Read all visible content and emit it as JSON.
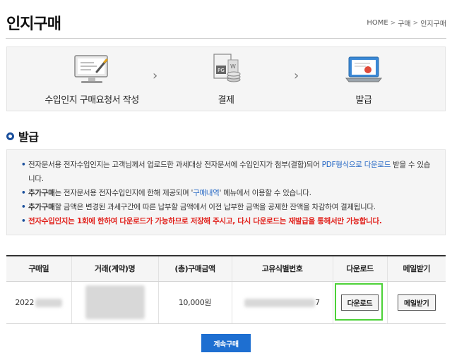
{
  "page": {
    "title": "인지구매"
  },
  "breadcrumb": {
    "home": "HOME",
    "sep": ">",
    "level1": "구매",
    "level2": "인지구매"
  },
  "steps": [
    {
      "label": "수입인지 구매요청서 작성",
      "icon": "monitor-pen-icon"
    },
    {
      "label": "결제",
      "icon": "payment-document-coins-icon"
    },
    {
      "label": "발급",
      "icon": "laptop-certificate-icon"
    }
  ],
  "step_arrow": "›",
  "section": {
    "title": "발급"
  },
  "notice": {
    "bullet": "•",
    "line1_a": "전자문서용 전자수입인지는 고객님께서 업로드한 과세대상 전자문서에 수입인지가 첨부(결합)되어 ",
    "line1_link": "PDF형식으로 다운로드",
    "line1_b": " 받을 수 있습니다.",
    "line2_bold": "추가구매",
    "line2_a": "는 전자문서용 전자수입인지에 한해 제공되며 '",
    "line2_link": "구매내역",
    "line2_b": "' 메뉴에서 이용할 수 있습니다.",
    "line3_bold": "추가구매",
    "line3_a": "할 금액은 변경된 과세구간에 따른 납부할 금액에서 이전 납부한 금액을 공제한 잔액을 차감하여 결제됩니다.",
    "line4_red": "전자수입인지는 1회에 한하여 다운로드가 가능하므로 저장해 주시고, 다시 다운로드는 재발급을 통해서만 가능합니다."
  },
  "table": {
    "headers": [
      "구매일",
      "거래(계약)명",
      "(총)구매금액",
      "고유식별번호",
      "다운로드",
      "메일받기"
    ],
    "row": {
      "date_visible": "2022",
      "amount": "10,000원",
      "id_visible_tail": "7",
      "download_label": "다운로드",
      "mail_label": "메일받기"
    }
  },
  "continue_button": "계속구매",
  "colors": {
    "accent_blue": "#1e6fd1",
    "link_blue": "#2366c4",
    "warning_red": "#e1201b",
    "highlight_green": "#4cd137"
  }
}
